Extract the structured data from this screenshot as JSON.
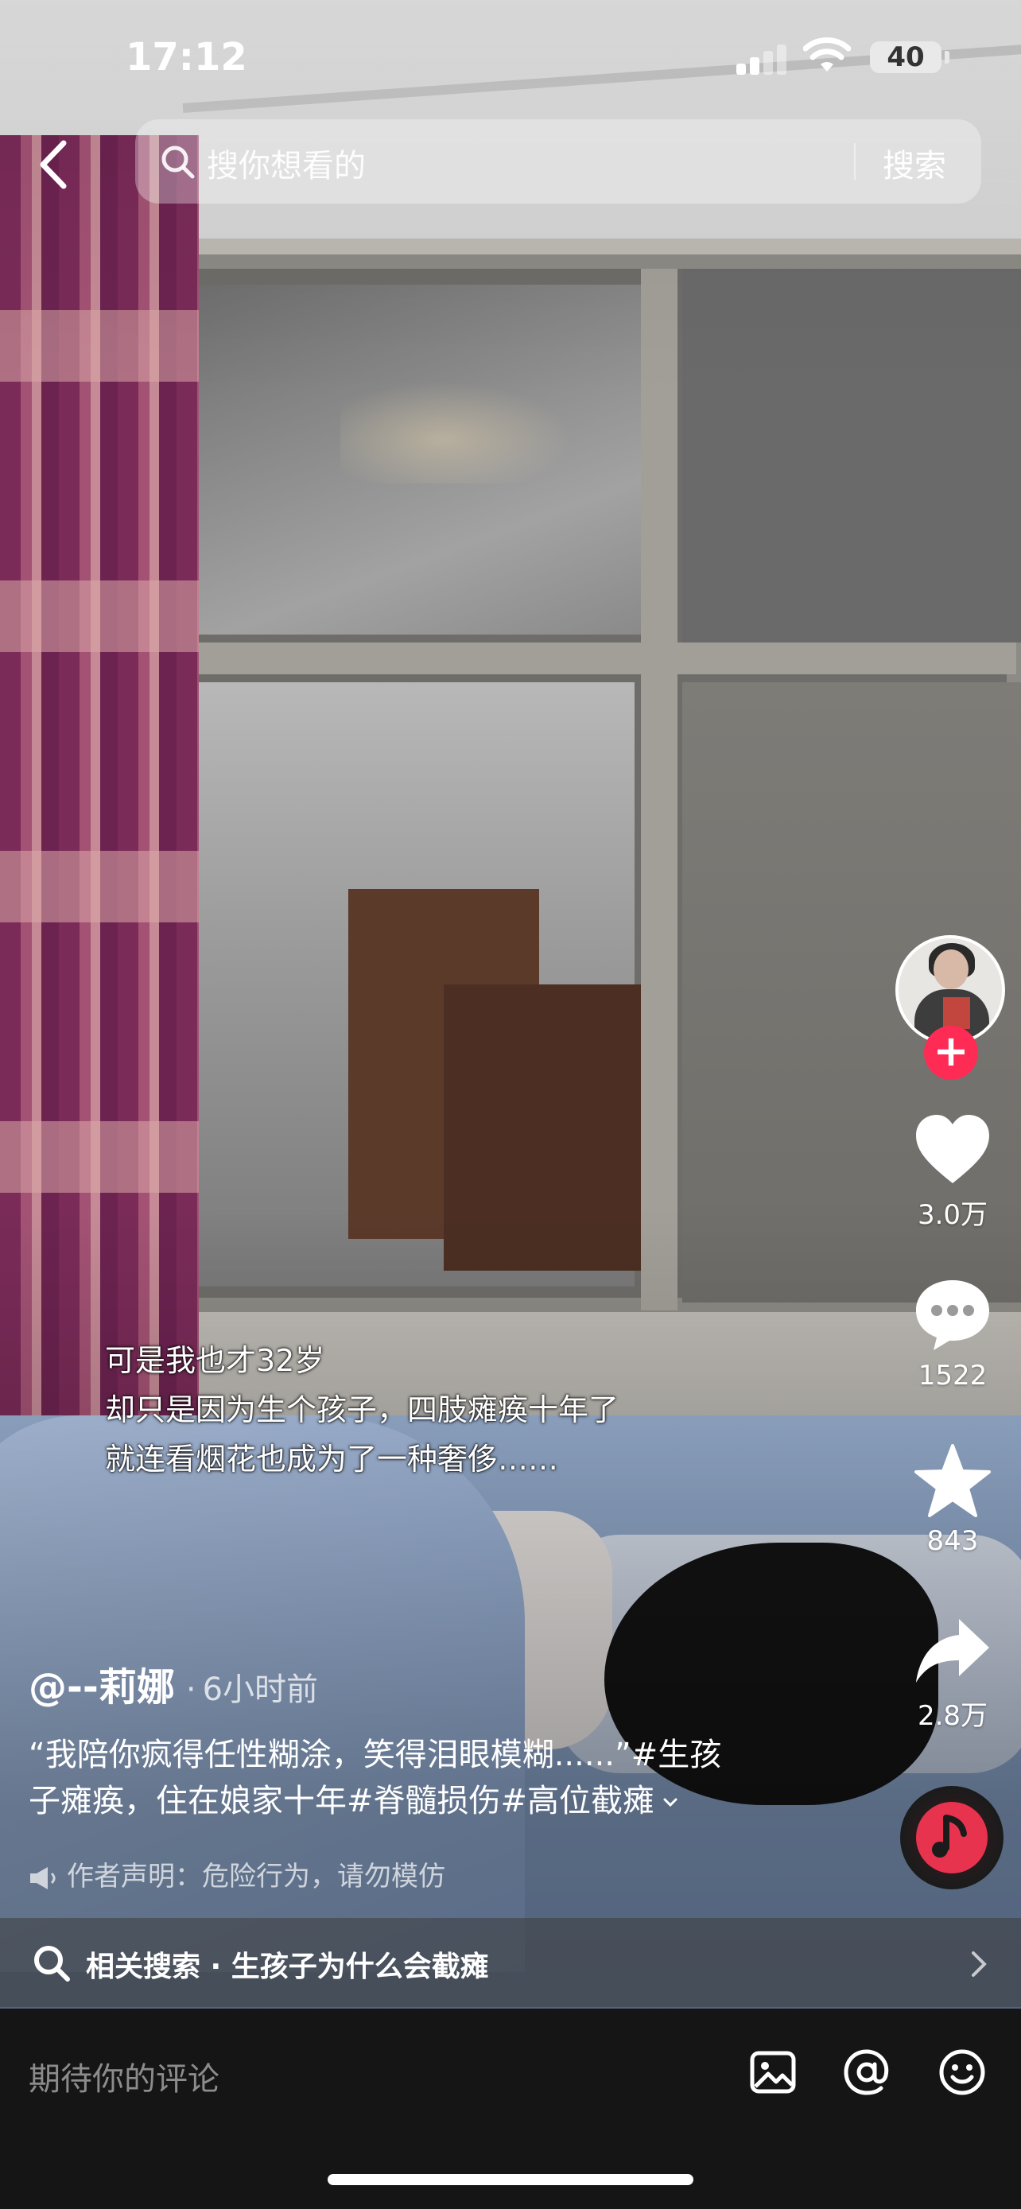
{
  "status_bar": {
    "time": "17:12",
    "battery": "40"
  },
  "search": {
    "placeholder": "搜你想看的",
    "button": "搜索"
  },
  "subtitles": {
    "line1": "可是我也才32岁",
    "line2": "却只是因为生个孩子，四肢瘫痪十年了",
    "line3": "就连看烟花也成为了一种奢侈……"
  },
  "rail": {
    "likes": "3.0万",
    "comments": "1522",
    "favorites": "843",
    "shares": "2.8万"
  },
  "post": {
    "author": "@--莉娜",
    "time_ago": "6小时前",
    "desc_line1": "“我陪你疯得任性糊涂，笑得泪眼模糊......”#生孩",
    "desc_line2": "子瘫痪，住在娘家十年#脊髓损伤#高位截瘫",
    "statement": "作者声明：危险行为，请勿模仿"
  },
  "related": {
    "label": "相关搜索 · 生孩子为什么会截瘫"
  },
  "comment_bar": {
    "placeholder": "期待你的评论"
  },
  "colors": {
    "accent": "#fe2c55",
    "music_disc": "#e8334f",
    "comment_bg": "#151515"
  }
}
